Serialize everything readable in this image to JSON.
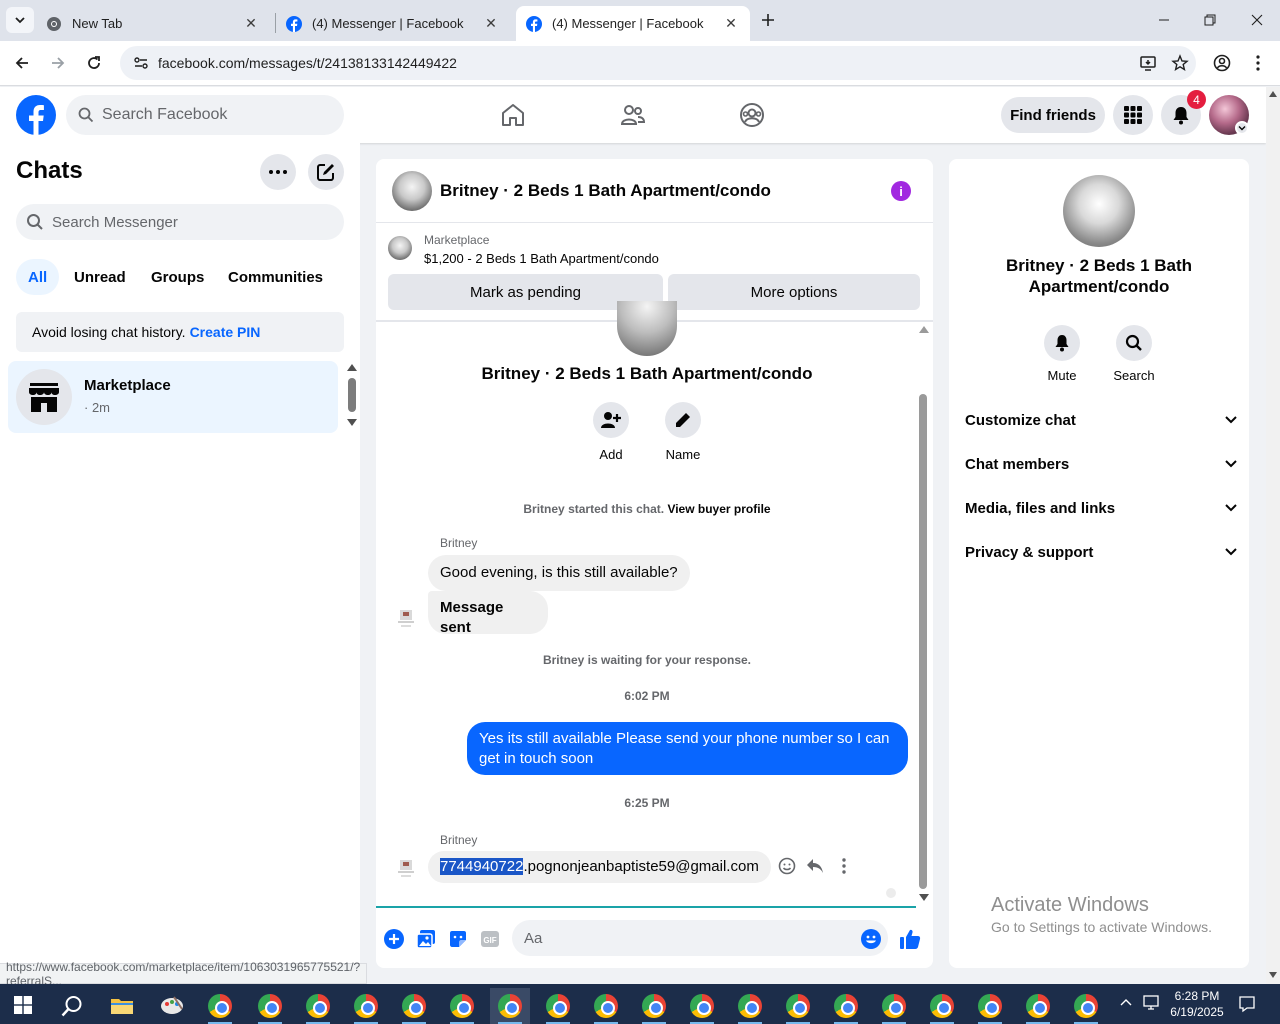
{
  "browser": {
    "tabs": [
      {
        "title": "New Tab",
        "active": false
      },
      {
        "title": "(4) Messenger | Facebook",
        "active": false
      },
      {
        "title": "(4) Messenger | Facebook",
        "active": true
      }
    ],
    "url": "facebook.com/messages/t/24138133142449422",
    "status_url": "https://www.facebook.com/marketplace/item/1063031965775521/?referralS..."
  },
  "header": {
    "search_placeholder": "Search Facebook",
    "find_friends": "Find friends",
    "notification_count": "4"
  },
  "sidebar": {
    "title": "Chats",
    "search_placeholder": "Search Messenger",
    "filters": [
      "All",
      "Unread",
      "Groups",
      "Communities"
    ],
    "pin_banner": {
      "text": "Avoid losing chat history.",
      "link": "Create PIN"
    },
    "chats": [
      {
        "name": "Marketplace",
        "time": "· 2m"
      }
    ]
  },
  "conversation": {
    "title": "Britney · 2 Beds 1 Bath Apartment/condo",
    "marketplace_label": "Marketplace",
    "listing": "$1,200 - 2 Beds 1 Bath Apartment/condo",
    "mark_pending": "Mark as pending",
    "more_options": "More options",
    "hero_name": "Britney · 2 Beds 1 Bath Apartment/condo",
    "actions": [
      {
        "label": "Add"
      },
      {
        "label": "Name"
      }
    ],
    "started_text": "Britney started this chat.",
    "buyer_profile_link": "View buyer profile",
    "sender1": "Britney",
    "msg1": "Good evening, is this still available?",
    "msg2": "Message sent",
    "waiting_text": "Britney is waiting for your response.",
    "time1": "6:02 PM",
    "msg_out": "Yes its still available Please send your phone number so I can get in touch soon",
    "time2": "6:25 PM",
    "sender2": "Britney",
    "msg3_selected": "7744940722",
    "msg3_rest": ".pognonjeanbaptiste59@gmail.com",
    "composer_placeholder": "Aa"
  },
  "info_panel": {
    "name": "Britney · 2 Beds 1 Bath Apartment/condo",
    "actions": [
      {
        "label": "Mute"
      },
      {
        "label": "Search"
      }
    ],
    "sections": [
      "Customize chat",
      "Chat members",
      "Media, files and links",
      "Privacy & support"
    ]
  },
  "watermark": {
    "title": "Activate Windows",
    "subtitle": "Go to Settings to activate Windows."
  },
  "taskbar": {
    "time": "6:28 PM",
    "date": "6/19/2025"
  },
  "colors": {
    "accent": "#0866ff",
    "info_purple": "#a128e0",
    "badge_red": "#e41e3f"
  }
}
